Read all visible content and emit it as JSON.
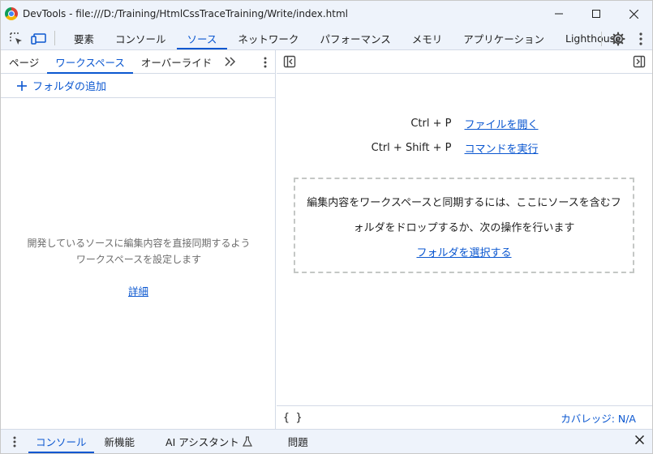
{
  "window": {
    "title": "DevTools - file:///D:/Training/HtmlCssTraceTraining/Write/index.html"
  },
  "main_tabs": [
    {
      "label": "要素"
    },
    {
      "label": "コンソール"
    },
    {
      "label": "ソース"
    },
    {
      "label": "ネットワーク"
    },
    {
      "label": "パフォーマンス"
    },
    {
      "label": "メモリ"
    },
    {
      "label": "アプリケーション"
    },
    {
      "label": "Lighthouse"
    }
  ],
  "navigator": {
    "tabs": [
      {
        "label": "ページ"
      },
      {
        "label": "ワークスペース"
      },
      {
        "label": "オーバーライド"
      }
    ],
    "more_tabs": "»",
    "add_folder_label": "フォルダの追加",
    "empty_message": "開発しているソースに編集内容を直接同期するようワークスペースを設定します",
    "learn_more": "詳細"
  },
  "editor": {
    "shortcuts": [
      {
        "keys": "Ctrl + P",
        "action": "ファイルを開く"
      },
      {
        "keys": "Ctrl + Shift + P",
        "action": "コマンドを実行"
      }
    ],
    "dropzone": {
      "line1": "編集内容をワークスペースと同期するには、ここにソースを含むフ",
      "line2": "ォルダをドロップするか、次の操作を行います",
      "link": "フォルダを選択する"
    },
    "format_icon_label": "{ }",
    "coverage": "カバレッジ: N/A"
  },
  "drawer": {
    "tabs": [
      {
        "label": "コンソール"
      },
      {
        "label": "新機能"
      },
      {
        "label": "AI アシスタント"
      },
      {
        "label": "問題"
      }
    ]
  },
  "colors": {
    "accent": "#0b57d0",
    "chrome_bg": "#eef3fb",
    "border": "#d3dae6",
    "muted_text": "#6d6d6d"
  },
  "state": {
    "active_main_tab": "ソース",
    "active_navigator_tab": "ワークスペース",
    "active_drawer_tab": "コンソール"
  }
}
